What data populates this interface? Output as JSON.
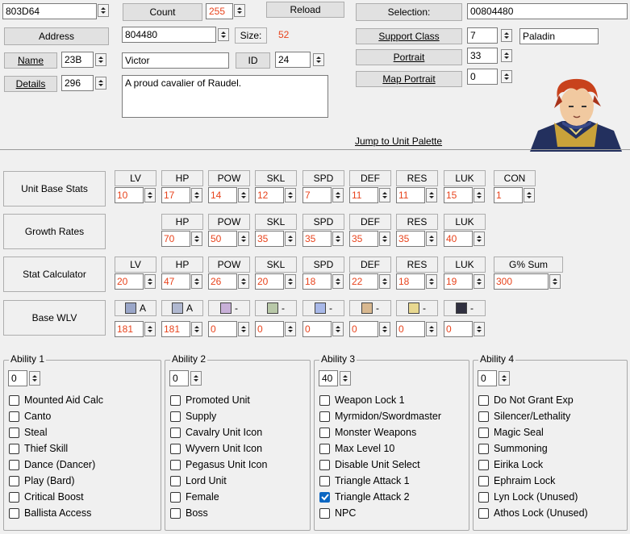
{
  "top": {
    "pointer": "803D64",
    "count_label": "Count",
    "count_value": "255",
    "reload_label": "Reload",
    "selection_label": "Selection:",
    "selection_value": "00804480",
    "address_label": "Address",
    "address_value": "804480",
    "size_label": "Size:",
    "size_value": "52",
    "name_label": "Name",
    "name_id": "23B",
    "name_text": "Victor",
    "id_label": "ID",
    "id_value": "24",
    "details_label": "Details",
    "details_id": "296",
    "details_text": "A proud cavalier of Raudel.",
    "support_class_label": "Support Class",
    "support_class_value": "7",
    "class_name": "Paladin",
    "portrait_label": "Portrait",
    "portrait_value": "33",
    "map_portrait_label": "Map Portrait",
    "map_portrait_value": "0",
    "jump_palette": "Jump to Unit Palette"
  },
  "rows": {
    "base_stats": "Unit Base Stats",
    "growth_rates": "Growth Rates",
    "stat_calc": "Stat Calculator",
    "base_wlv": "Base WLV"
  },
  "headers": {
    "lv": "LV",
    "hp": "HP",
    "pow": "POW",
    "skl": "SKL",
    "spd": "SPD",
    "def": "DEF",
    "res": "RES",
    "luk": "LUK",
    "con": "CON",
    "gsum": "G% Sum"
  },
  "base": {
    "lv": "10",
    "hp": "17",
    "pow": "14",
    "skl": "12",
    "spd": "7",
    "def": "11",
    "res": "11",
    "luk": "15",
    "con": "1"
  },
  "growth": {
    "hp": "70",
    "pow": "50",
    "skl": "35",
    "spd": "35",
    "def": "35",
    "res": "35",
    "luk": "40"
  },
  "calc": {
    "lv": "20",
    "hp": "47",
    "pow": "26",
    "skl": "20",
    "spd": "18",
    "def": "22",
    "res": "18",
    "luk": "19",
    "gsum": "300"
  },
  "wlv": {
    "ranks": [
      "A",
      "A",
      "-",
      "-",
      "-",
      "-",
      "-",
      "-"
    ],
    "values": [
      "181",
      "181",
      "0",
      "0",
      "0",
      "0",
      "0",
      "0"
    ],
    "icons": [
      "sword-icon",
      "lance-icon",
      "axe-icon",
      "bow-icon",
      "staff-icon",
      "anima-icon",
      "light-icon",
      "dark-icon"
    ]
  },
  "abilities": [
    {
      "title": "Ability 1",
      "value": "0",
      "items": [
        "Mounted Aid Calc",
        "Canto",
        "Steal",
        "Thief Skill",
        "Dance (Dancer)",
        "Play (Bard)",
        "Critical Boost",
        "Ballista Access"
      ],
      "checked": [
        false,
        false,
        false,
        false,
        false,
        false,
        false,
        false
      ]
    },
    {
      "title": "Ability 2",
      "value": "0",
      "items": [
        "Promoted Unit",
        "Supply",
        "Cavalry Unit Icon",
        "Wyvern Unit Icon",
        "Pegasus Unit Icon",
        "Lord Unit",
        "Female",
        "Boss"
      ],
      "checked": [
        false,
        false,
        false,
        false,
        false,
        false,
        false,
        false
      ]
    },
    {
      "title": "Ability 3",
      "value": "40",
      "items": [
        "Weapon Lock 1",
        "Myrmidon/Swordmaster",
        "Monster Weapons",
        "Max Level 10",
        "Disable Unit Select",
        "Triangle Attack 1",
        "Triangle Attack 2",
        "NPC"
      ],
      "checked": [
        false,
        false,
        false,
        false,
        false,
        false,
        true,
        false
      ]
    },
    {
      "title": "Ability 4",
      "value": "0",
      "items": [
        "Do Not Grant Exp",
        "Silencer/Lethality",
        "Magic Seal",
        "Summoning",
        "Eirika Lock",
        "Ephraim Lock",
        "Lyn Lock (Unused)",
        "Athos Lock (Unused)"
      ],
      "checked": [
        false,
        false,
        false,
        false,
        false,
        false,
        false,
        false
      ]
    }
  ],
  "colors": {
    "value_red": "#e8431c",
    "check_blue": "#0a66c2"
  }
}
